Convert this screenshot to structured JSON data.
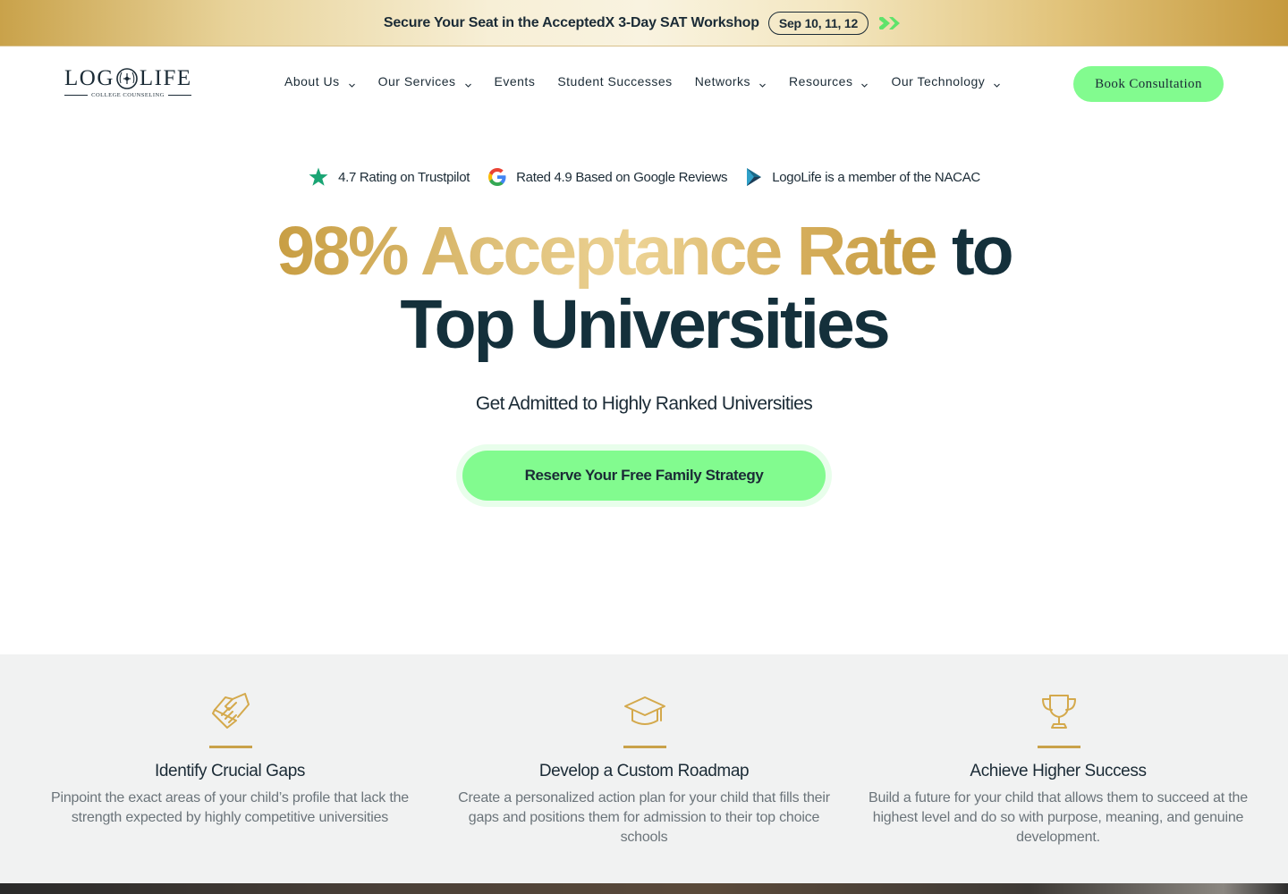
{
  "promo": {
    "text": "Secure Your Seat in the AcceptedX 3-Day SAT Workshop",
    "dates": "Sep 10, 11, 12",
    "arrow_icon": "double-chevron-right-icon",
    "arrow_color": "#5fe36b"
  },
  "logo": {
    "word_left": "LOG",
    "word_right": "LIFE",
    "tagline": "COLLEGE COUNSELING"
  },
  "nav": {
    "items": [
      {
        "label": "About Us",
        "has_dropdown": true
      },
      {
        "label": "Our Services",
        "has_dropdown": true
      },
      {
        "label": "Events",
        "has_dropdown": false
      },
      {
        "label": "Student Successes",
        "has_dropdown": false
      },
      {
        "label": "Networks",
        "has_dropdown": true
      },
      {
        "label": "Resources",
        "has_dropdown": true
      },
      {
        "label": "Our Technology",
        "has_dropdown": true
      }
    ],
    "cta_label": "Book Consultation"
  },
  "ratings": [
    {
      "icon": "star-icon",
      "text": "4.7 Rating on Trustpilot"
    },
    {
      "icon": "google-icon",
      "text": "Rated 4.9 Based on Google Reviews"
    },
    {
      "icon": "nacac-icon",
      "text": "LogoLife is a member of the NACAC"
    }
  ],
  "hero": {
    "title_gold": "98% Acceptance Rate",
    "title_dark_1": "to",
    "title_dark_2": "Top Universities",
    "subtitle": "Get Admitted to Highly Ranked Universities",
    "cta_label": "Reserve Your Free Family Strategy"
  },
  "features": [
    {
      "icon": "handshake-icon",
      "title": "Identify Crucial Gaps",
      "description": "Pinpoint the exact areas of your child’s profile that lack the strength expected by highly competitive universities"
    },
    {
      "icon": "graduation-cap-icon",
      "title": "Develop a Custom Roadmap",
      "description": "Create a personalized action plan for your child that fills their gaps and positions them for admission to their top choice schools"
    },
    {
      "icon": "trophy-icon",
      "title": "Achieve Higher Success",
      "description": "Build a future for your child that allows them to succeed at the highest level and do so with purpose, meaning, and genuine development."
    }
  ],
  "colors": {
    "accent_green": "#82fb8f",
    "gold": "#c9a24a",
    "navy": "#14303b",
    "feature_bg": "#f1f2f2"
  }
}
